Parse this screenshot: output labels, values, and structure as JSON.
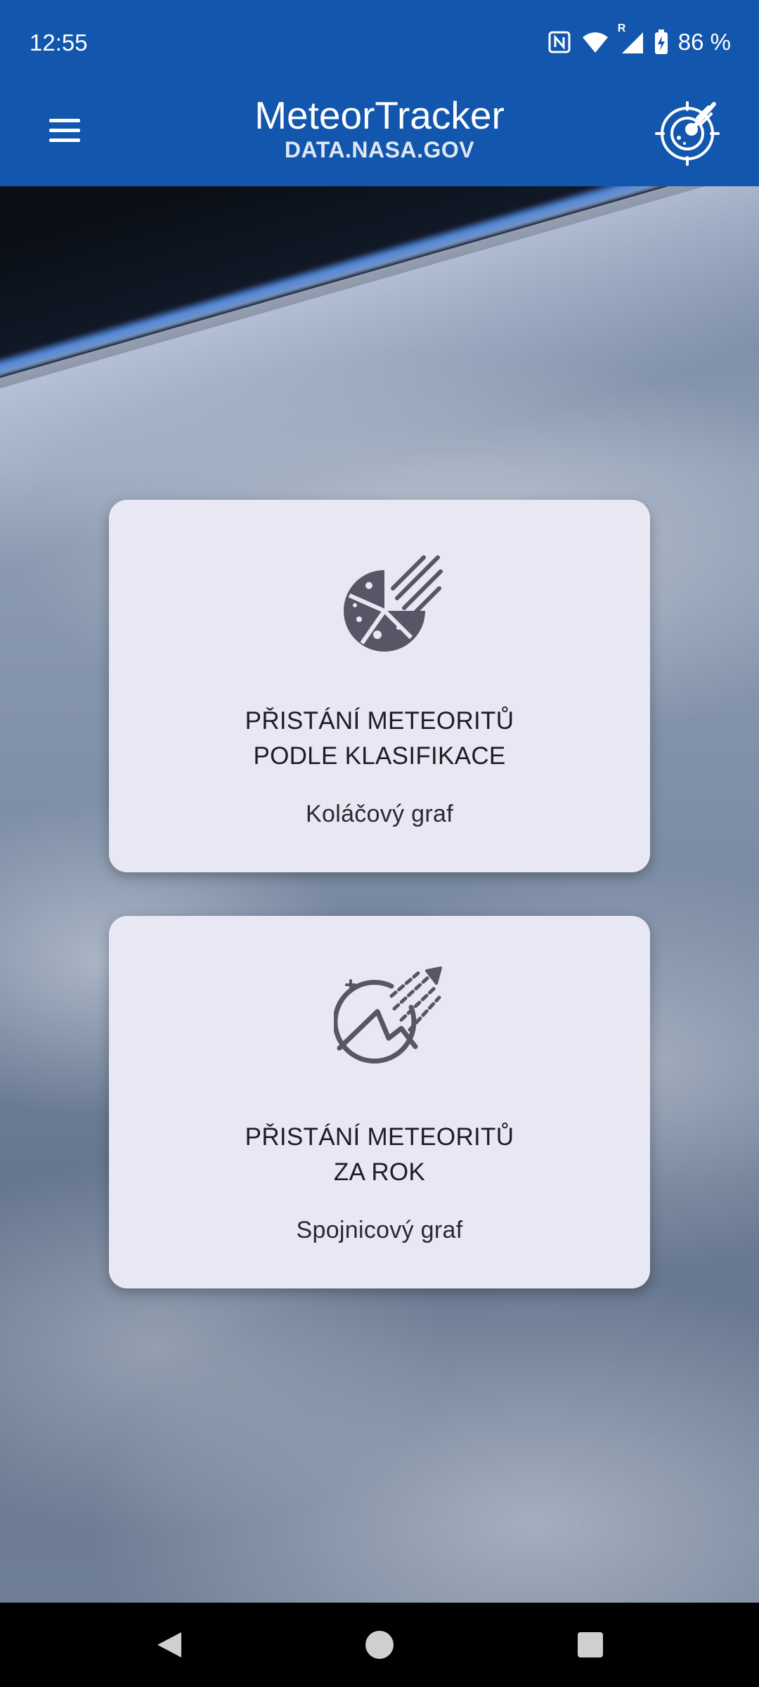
{
  "status_bar": {
    "time": "12:55",
    "battery_text": "86 %",
    "roaming_indicator": "R",
    "icons": [
      "nfc-icon",
      "wifi-icon",
      "signal-icon",
      "battery-charging-icon"
    ]
  },
  "app_bar": {
    "title": "MeteorTracker",
    "subtitle": "DATA.NASA.GOV",
    "menu_icon": "hamburger-menu-icon",
    "logo_icon": "meteor-radar-logo-icon",
    "background_color": "#1256ad"
  },
  "cards": [
    {
      "icon": "meteor-pie-chart-icon",
      "title_line1": "PŘISTÁNÍ METEORITŮ",
      "title_line2": "PODLE KLASIFIKACE",
      "subtitle": "Koláčový graf"
    },
    {
      "icon": "meteor-line-chart-icon",
      "title_line1": "PŘISTÁNÍ METEORITŮ",
      "title_line2": "ZA ROK",
      "subtitle": "Spojnicový graf"
    }
  ],
  "nav_bar": {
    "back": "back-icon",
    "home": "home-icon",
    "recents": "recents-icon"
  },
  "colors": {
    "card_background": "#e8e8f4",
    "icon_color": "#5a5566",
    "nav_background": "#000000"
  }
}
